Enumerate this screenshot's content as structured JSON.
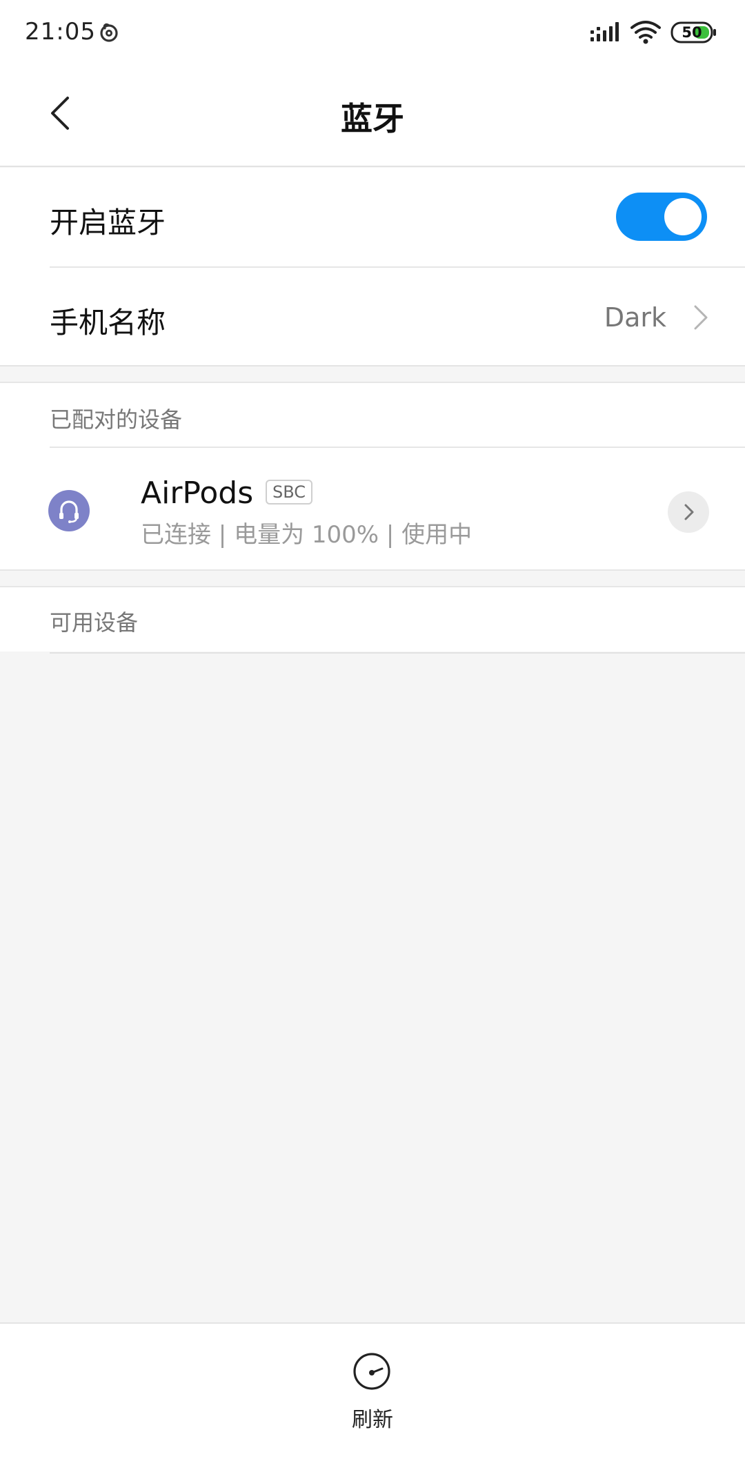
{
  "status_bar": {
    "time": "21:05",
    "battery_level": "50",
    "icons": [
      "netease-music-icon",
      "signal-icon",
      "wifi-icon",
      "battery-icon"
    ]
  },
  "header": {
    "title": "蓝牙",
    "back_icon": "back-arrow-icon"
  },
  "settings": {
    "bluetooth_toggle": {
      "label": "开启蓝牙",
      "enabled": true
    },
    "phone_name": {
      "label": "手机名称",
      "value": "Dark"
    }
  },
  "paired_devices": {
    "section_title": "已配对的设备",
    "devices": [
      {
        "name": "AirPods",
        "codec": "SBC",
        "status": "已连接 | 电量为 100% | 使用中",
        "icon": "headset-icon"
      }
    ]
  },
  "available_devices": {
    "section_title": "可用设备"
  },
  "bottom_bar": {
    "refresh_label": "刷新",
    "refresh_icon": "refresh-icon"
  },
  "colors": {
    "accent": "#0d8ff5",
    "device_icon_bg": "#7e82c8",
    "background": "#f5f5f5"
  }
}
